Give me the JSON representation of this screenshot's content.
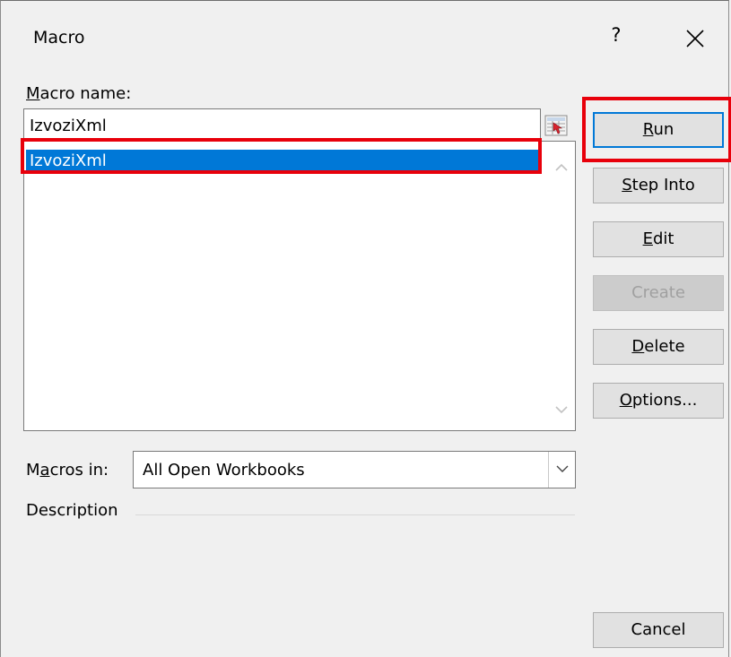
{
  "window": {
    "title": "Macro",
    "help_label": "?"
  },
  "macro_name": {
    "label_prefix": "",
    "label_accel": "M",
    "label_rest": "acro name:",
    "value": "IzvoziXml"
  },
  "macro_list": {
    "items": [
      "IzvoziXml"
    ],
    "selected_index": 0
  },
  "buttons": {
    "run": {
      "accel": "R",
      "rest": "un"
    },
    "step_into": {
      "accel": "S",
      "rest": "tep Into"
    },
    "edit": {
      "accel": "E",
      "rest": "dit"
    },
    "create": {
      "label": "Create"
    },
    "delete": {
      "accel": "D",
      "rest": "elete"
    },
    "options": {
      "accel": "O",
      "rest": "ptions..."
    },
    "cancel": {
      "label": "Cancel"
    }
  },
  "macros_in": {
    "label_prefix": "M",
    "label_accel": "a",
    "label_rest": "cros in:",
    "selected": "All Open Workbooks"
  },
  "description": {
    "label": "Description"
  },
  "colors": {
    "selection": "#0078d7",
    "highlight": "#e8000b",
    "default_border": "#0078d7"
  }
}
